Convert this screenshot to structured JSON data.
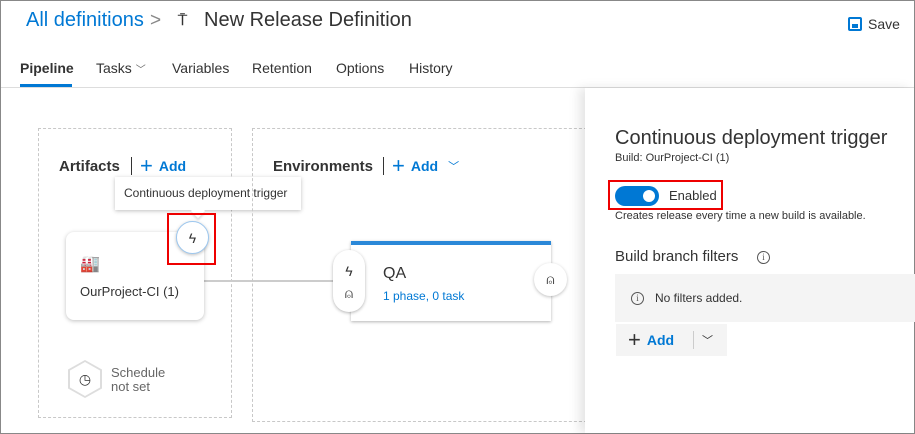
{
  "header": {
    "breadcrumb": "All definitions",
    "separator": ">",
    "title": "New Release Definition",
    "save_label": "Save"
  },
  "tabs": [
    {
      "label": "Pipeline"
    },
    {
      "label": "Tasks"
    },
    {
      "label": "Variables"
    },
    {
      "label": "Retention"
    },
    {
      "label": "Options"
    },
    {
      "label": "History"
    }
  ],
  "artifacts": {
    "heading": "Artifacts",
    "add_label": "Add",
    "tooltip": "Continuous deployment trigger",
    "artifact_name": "OurProject-CI (1)",
    "schedule_line1": "Schedule",
    "schedule_line2": "not set"
  },
  "environments": {
    "heading": "Environments",
    "add_label": "Add",
    "env_name": "QA",
    "env_detail": "1 phase, 0 task"
  },
  "panel": {
    "title": "Continuous deployment trigger",
    "subtitle": "Build: OurProject-CI (1)",
    "toggle_label": "Enabled",
    "toggle_on": true,
    "description": "Creates release every time a new build is available.",
    "filters_heading": "Build branch filters",
    "no_filters": "No filters added.",
    "add_label": "Add"
  },
  "colors": {
    "accent": "#0078d4",
    "highlight": "#e00000"
  }
}
